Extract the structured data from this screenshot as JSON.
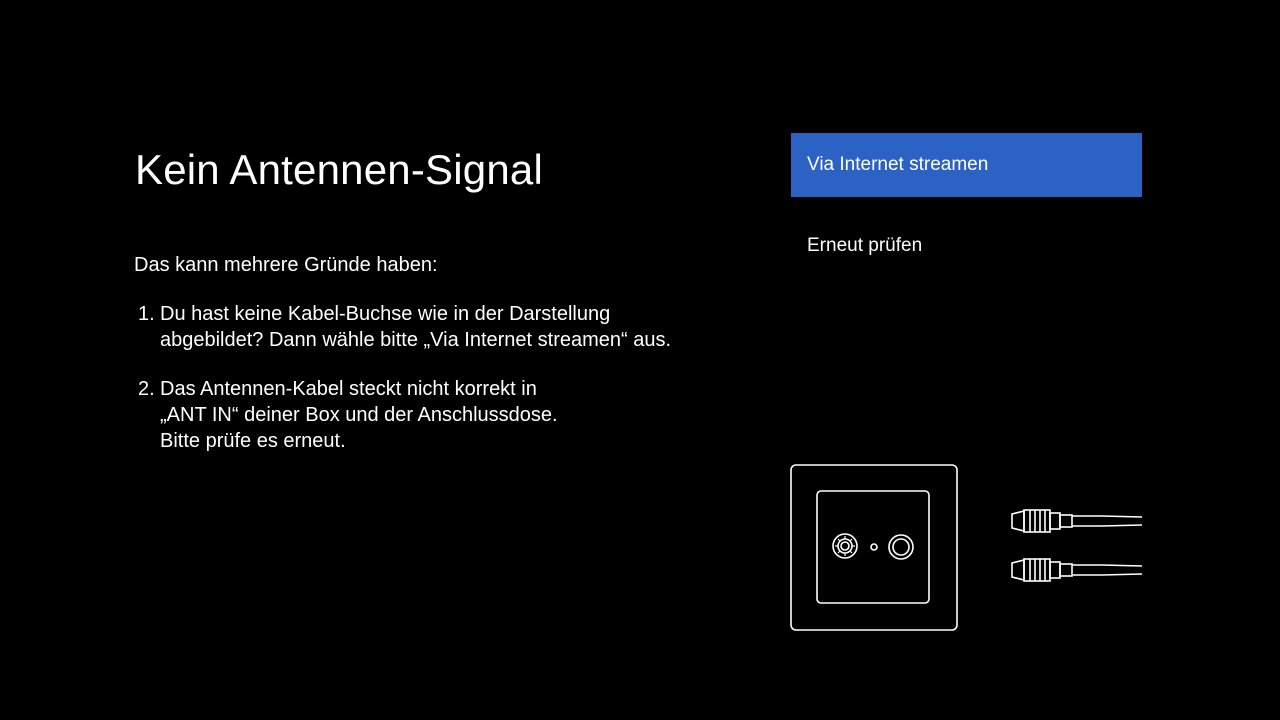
{
  "page": {
    "title": "Kein Antennen-Signal",
    "intro": "Das kann mehrere Gründe haben:",
    "reasons": [
      {
        "number": "1.",
        "lines": [
          "Du hast keine Kabel-Buchse wie in der Darstellung",
          "abgebildet? Dann wähle bitte „Via Internet streamen“ aus."
        ]
      },
      {
        "number": "2.",
        "lines": [
          "Das Antennen-Kabel steckt nicht korrekt in",
          "„ANT IN“ deiner Box und der Anschlussdose.",
          "Bitte prüfe es erneut."
        ]
      }
    ]
  },
  "menu": {
    "options": [
      {
        "label": "Via Internet streamen",
        "focused": true
      },
      {
        "label": "Erneut prüfen",
        "focused": false
      }
    ]
  },
  "illustration": {
    "icons": [
      "antenna-wall-socket-icon",
      "coax-cable-plug-icon"
    ]
  },
  "colors": {
    "background": "#000000",
    "text": "#ffffff",
    "focus_highlight": "#2b62c4"
  }
}
